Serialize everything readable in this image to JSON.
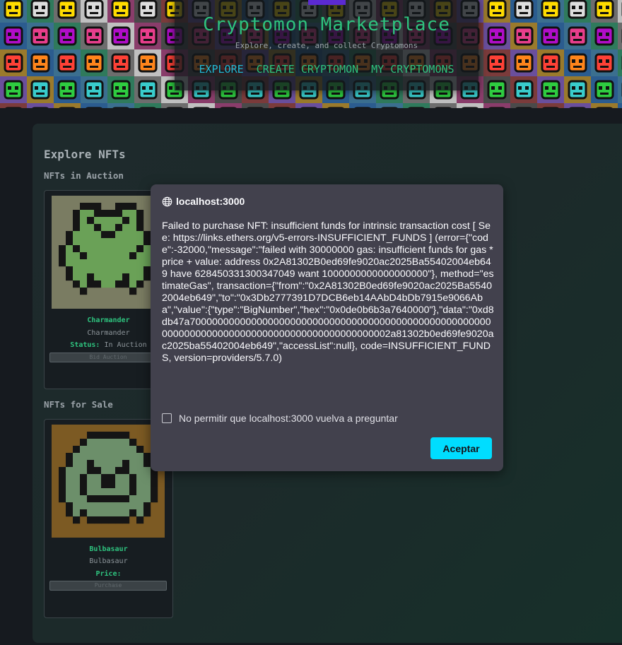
{
  "header": {
    "title": "Cryptomon Marketplace",
    "subtitle": "Explore, create, and collect Cryptomons",
    "nav": [
      {
        "label": "EXPLORE",
        "active": true
      },
      {
        "label": "CREATE CRYPTOMON",
        "active": false
      },
      {
        "label": "MY CRYPTOMONS",
        "active": false
      }
    ]
  },
  "main": {
    "title": "Explore NFTs",
    "auction_section": {
      "title": "NFTs in Auction",
      "card": {
        "name": "Charmander",
        "sub": "Charmander",
        "status_label": "Status:",
        "status_value": "In Auction",
        "button_label": "Bid Auction",
        "image_colors": {
          "bg": "#7a7c62",
          "fill": "#6aa157",
          "dark": "#151515"
        }
      }
    },
    "sale_section": {
      "title": "NFTs for Sale",
      "card": {
        "name": "Bulbasaur",
        "sub": "Bulbasaur",
        "price_label": "Price:",
        "price_value": "",
        "button_label": "Purchase",
        "image_colors": {
          "bg": "#7c5a23",
          "fill": "#6c8f6a",
          "dark": "#151515"
        }
      }
    }
  },
  "dialog": {
    "origin": "localhost:3000",
    "icon": "globe-icon",
    "message": "Failed to purchase NFT: insufficient funds for intrinsic transaction cost [ See: https://links.ethers.org/v5-errors-INSUFFICIENT_FUNDS ] (error={\"code\":-32000,\"message\":\"failed with 30000000 gas: insufficient funds for gas * price + value: address 0x2A81302B0ed69fe9020ac2025Ba55402004eb649 have 628450331300347049 want 1000000000000000000\"}, method=\"estimateGas\", transaction={\"from\":\"0x2A81302B0ed69fe9020ac2025Ba55402004eb649\",\"to\":\"0x3Db2777391D7DCB6eb14AAbD4bDb7915e9066Aba\",\"value\":{\"type\":\"BigNumber\",\"hex\":\"0x0de0b6b3a7640000\"},\"data\":\"0xd8db47a70000000000000000000000000000000000000000000000000000000000000000000000000000000000000000000002a81302b0ed69fe9020ac2025ba55402004eb649\",\"accessList\":null}, code=INSUFFICIENT_FUNDS, version=providers/5.7.0)",
    "checkbox_label": "No permitir que localhost:3000 vuelva a preguntar",
    "checkbox_checked": false,
    "ok_label": "Aceptar"
  },
  "colors": {
    "accent": "#2ec27e",
    "nav_active": "#22b8d4",
    "dialog_button": "#00ddff"
  }
}
